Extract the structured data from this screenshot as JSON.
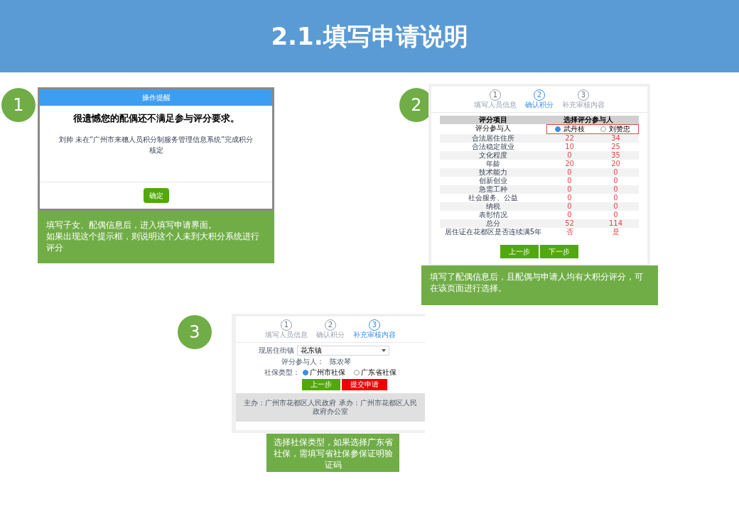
{
  "header": {
    "title": "2.1.填写申请说明"
  },
  "markers": [
    "1",
    "2",
    "3"
  ],
  "captions": [
    [
      "填写子女、配偶信息后，进入填写申请界面。",
      "如果出现这个提示框，则说明这个人未到大积分系统进行评分"
    ],
    [
      "填写了配偶信息后，且配偶与申请人均有大积分评分，可在该页面进行选择。"
    ],
    [
      "选择社保类型，如果选择广东省社保，需填写省社保参保证明验证码"
    ]
  ],
  "dialog_screen": {
    "title": "操作提醒",
    "heading": "很遗憾您的配偶还不满足参与评分要求。",
    "message": "刘帅 未在“广州市来穗人员积分制服务管理信息系统”完成积分核定",
    "button": "确定"
  },
  "score_screen": {
    "steps": [
      {
        "number": "1",
        "label": "填写人员信息",
        "selected": false
      },
      {
        "number": "2",
        "label": "确认积分",
        "selected": true
      },
      {
        "number": "3",
        "label": "补充审核内容",
        "selected": false
      }
    ],
    "columns": [
      "评分项目",
      "选择评分参与人"
    ],
    "participant": {
      "label": "评分参与人",
      "options": [
        {
          "name": "武丹枝",
          "selected": true
        },
        {
          "name": "刘赞忠",
          "selected": false
        }
      ]
    },
    "rows": [
      {
        "label": "合法居住住所",
        "values": [
          "22",
          "34"
        ]
      },
      {
        "label": "合法稳定就业",
        "values": [
          "10",
          "25"
        ]
      },
      {
        "label": "文化程度",
        "values": [
          "0",
          "35"
        ]
      },
      {
        "label": "年龄",
        "values": [
          "20",
          "20"
        ]
      },
      {
        "label": "技术能力",
        "values": [
          "0",
          "0"
        ]
      },
      {
        "label": "创新创业",
        "values": [
          "0",
          "0"
        ]
      },
      {
        "label": "急需工种",
        "values": [
          "0",
          "0"
        ]
      },
      {
        "label": "社会服务、公益",
        "values": [
          "0",
          "0"
        ]
      },
      {
        "label": "纳税",
        "values": [
          "0",
          "0"
        ]
      },
      {
        "label": "表彰情况",
        "values": [
          "0",
          "0"
        ]
      },
      {
        "label": "总分",
        "values": [
          "52",
          "114"
        ]
      },
      {
        "label": "居住证在花都区是否连续满5年",
        "values": [
          "否",
          "是"
        ]
      }
    ],
    "buttons": [
      "上一步",
      "下一步"
    ]
  },
  "social_screen": {
    "steps": [
      {
        "number": "1",
        "label": "填写人员信息",
        "selected": false
      },
      {
        "number": "2",
        "label": "确认积分",
        "selected": false
      },
      {
        "number": "3",
        "label": "补充审核内容",
        "selected": true
      }
    ],
    "town_label": "现居住街镇",
    "town_value": "花东镇",
    "participant_label": "评分参与人：",
    "participant_value": "陈农琴",
    "type_label": "社保类型：",
    "types": [
      {
        "name": "广州市社保",
        "selected": true
      },
      {
        "name": "广东省社保",
        "selected": false
      }
    ],
    "buttons": [
      "上一步",
      "提交申请"
    ],
    "footer": "主办：广州市花都区人民政府 承办：广州市花都区人民政府办公室"
  }
}
